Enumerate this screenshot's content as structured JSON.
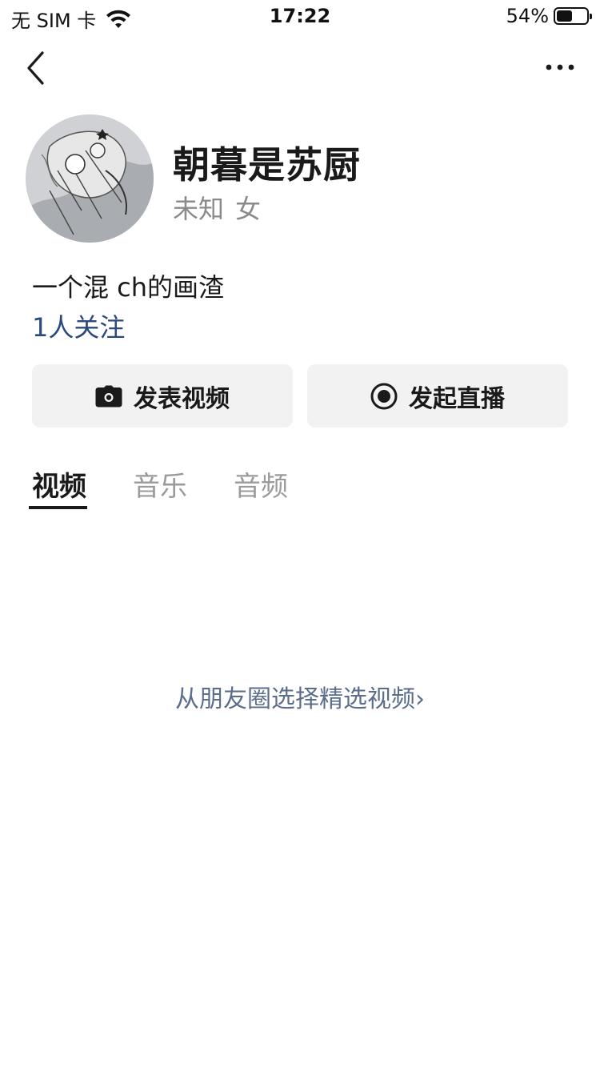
{
  "status_bar": {
    "carrier": "无 SIM 卡",
    "time": "17:22",
    "battery_percent_text": "54%",
    "battery_level": 0.54
  },
  "nav": {
    "back_icon": "chevron-left-icon",
    "more_icon": "more-dots-icon"
  },
  "profile": {
    "name": "朝暮是苏厨",
    "region": "未知",
    "gender": "女",
    "bio": "一个混 ch的画渣",
    "followers": "1人关注"
  },
  "actions": {
    "publish_label": "发表视频",
    "publish_icon": "camera-icon",
    "live_label": "发起直播",
    "live_icon": "record-icon"
  },
  "tabs": [
    {
      "label": "视频",
      "active": true
    },
    {
      "label": "音乐",
      "active": false
    },
    {
      "label": "音频",
      "active": false
    }
  ],
  "empty_state": {
    "link_text": "从朋友圈选择精选视频",
    "link_arrow": "›"
  },
  "colors": {
    "link_blue": "#2a4a7e",
    "muted_link": "#5c6d8c",
    "button_bg": "#f2f2f2"
  }
}
